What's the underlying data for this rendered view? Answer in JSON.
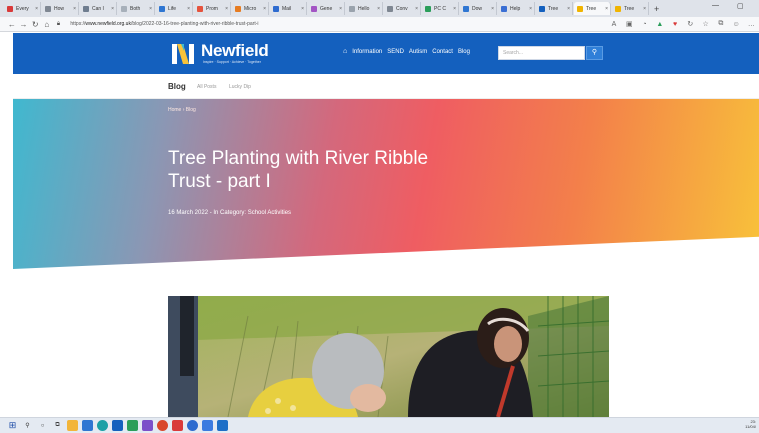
{
  "browser": {
    "tabs": [
      {
        "label": "Every",
        "color": "#d93a3a"
      },
      {
        "label": "How",
        "color": "#7f8792"
      },
      {
        "label": "Can I",
        "color": "#6f7d8f"
      },
      {
        "label": "Both",
        "color": "#a7b0ba"
      },
      {
        "label": "Life",
        "color": "#2f76d2"
      },
      {
        "label": "Prom",
        "color": "#e5533d"
      },
      {
        "label": "Micro",
        "color": "#e67c22"
      },
      {
        "label": "Mail",
        "color": "#2e6bcf"
      },
      {
        "label": "Gene",
        "color": "#a355c4"
      },
      {
        "label": "Hello",
        "color": "#9aa3ad"
      },
      {
        "label": "Conv",
        "color": "#7f8792"
      },
      {
        "label": "PC C",
        "color": "#2b9e5a"
      },
      {
        "label": "Dow",
        "color": "#2f76d2"
      },
      {
        "label": "Help",
        "color": "#3b6fd4"
      },
      {
        "label": "Tree",
        "color": "#1460be"
      },
      {
        "label": "Tree",
        "color": "#f0b400"
      },
      {
        "label": "Tree",
        "color": "#f0b400"
      }
    ],
    "url_prefix": "https://",
    "url_host": "www.newfield.org.uk",
    "url_path": "/blog/2022-03-16-tree-planting-with-river-ribble-trust-part-i"
  },
  "header": {
    "logo_text": "Newfield",
    "tagline": "Inspire · Support · Achieve · Together",
    "nav": [
      "Information",
      "SEND",
      "Autism",
      "Contact",
      "Blog"
    ],
    "home_icon": "home-icon",
    "search_placeholder": "Search...",
    "colors": {
      "brand": "#1460be"
    }
  },
  "subnav": {
    "current": "Blog",
    "all_posts": "All Posts",
    "lucky_dip": "Lucky Dip"
  },
  "hero": {
    "breadcrumb_home": "Home",
    "breadcrumb_sep": "›",
    "breadcrumb_current": "Blog",
    "title": "Tree Planting with River Ribble Trust - part I",
    "meta": "16 March 2022 - In Category: School Activities"
  },
  "taskbar": {
    "time": "23:",
    "date": "11/04/"
  }
}
